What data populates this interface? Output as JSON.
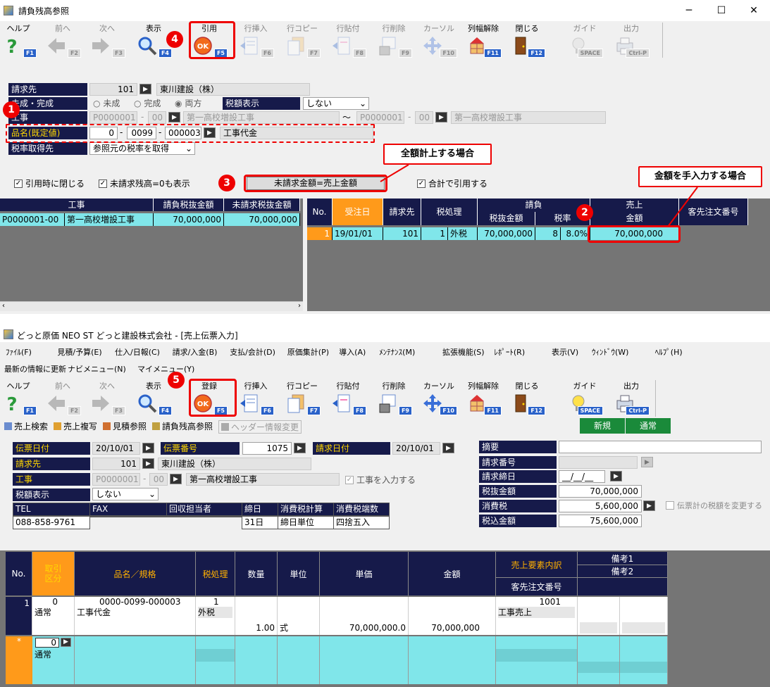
{
  "top": {
    "title": "請負残高参照",
    "toolbar": [
      {
        "label": "ヘルプ",
        "key": "F1",
        "icon": "help-icon",
        "enabled": true
      },
      {
        "label": "前へ",
        "key": "F2",
        "icon": "arrow-left-icon",
        "enabled": false
      },
      {
        "label": "次へ",
        "key": "F3",
        "icon": "arrow-right-icon",
        "enabled": false
      },
      {
        "label": "表示",
        "key": "F4",
        "icon": "magnifier-icon",
        "enabled": true
      },
      {
        "label": "引用",
        "key": "F5",
        "icon": "ok-icon",
        "enabled": true
      },
      {
        "label": "行挿入",
        "key": "F6",
        "icon": "row-insert-icon",
        "enabled": false
      },
      {
        "label": "行コピー",
        "key": "F7",
        "icon": "row-copy-icon",
        "enabled": false
      },
      {
        "label": "行貼付",
        "key": "F8",
        "icon": "row-paste-icon",
        "enabled": false
      },
      {
        "label": "行削除",
        "key": "F9",
        "icon": "row-delete-icon",
        "enabled": false
      },
      {
        "label": "カーソル",
        "key": "F10",
        "icon": "cursor-icon",
        "enabled": false
      },
      {
        "label": "列幅解除",
        "key": "F11",
        "icon": "column-width-icon",
        "enabled": true
      },
      {
        "label": "閉じる",
        "key": "F12",
        "icon": "door-icon",
        "enabled": true
      },
      {
        "label": "ガイド",
        "key": "SPACE",
        "icon": "bulb-icon",
        "enabled": false
      },
      {
        "label": "出力",
        "key": "Ctrl-P",
        "icon": "printer-icon",
        "enabled": false
      }
    ],
    "form": {
      "seikyu_label": "請求先",
      "seikyu_code": "101",
      "seikyu_name": "東川建設（株）",
      "mikan_label": "未成・完成",
      "radio1": "未成",
      "radio2": "完成",
      "radio3": "両方",
      "zei_label": "税額表示",
      "zei_value": "しない",
      "koji_label": "工事",
      "koji_from": "P0000001",
      "koji_from_sub": "00",
      "koji_from_name": "第一高校増設工事",
      "tilde": "～",
      "koji_to": "P0000001",
      "koji_to_sub": "00",
      "koji_to_name": "第一高校増設工事",
      "hinmei_label": "品名(既定値)",
      "hin1": "0",
      "hin2": "0099",
      "hin3": "000003",
      "hin_name": "工事代金",
      "zeiritsu_label": "税率取得先",
      "zeiritsu_value": "参照元の税率を取得",
      "chk1": "引用時に閉じる",
      "chk2": "未請求残高=0も表示",
      "btn_label": "未請求金額=売上金額",
      "chk3": "合計で引用する"
    },
    "left_grid": {
      "headers": [
        "工事",
        "請負税抜金額",
        "未請求税抜金額"
      ],
      "row": [
        "P0000001-00",
        "第一高校増設工事",
        "70,000,000",
        "70,000,000"
      ]
    },
    "right_grid": {
      "h_no": "No.",
      "h_date": "受注日",
      "h_seikyu": "請求先",
      "h_zei": "税処理",
      "h_ukeoi": "請負",
      "h_zeinuki": "税抜金額",
      "h_zeiritsu": "税率",
      "h_uriage": "売上",
      "h_kingaku": "金額",
      "h_kyaku": "客先注文番号",
      "row": {
        "no": "1",
        "date": "19/01/01",
        "seikyu": "101",
        "zeicode": "1",
        "zei": "外税",
        "zeinuki": "70,000,000",
        "rate_code": "8",
        "rate": "8.0%",
        "kingaku": "70,000,000",
        "kyaku": ""
      }
    },
    "callout1": "全額計上する場合",
    "callout2": "金額を手入力する場合"
  },
  "bottom": {
    "title": "どっと原価 NEO ST どっと建設株式会社 - [売上伝票入力]",
    "menu": [
      "ﾌｧｲﾙ(F)",
      "見積/予算(E)",
      "仕入/日報(C)",
      "請求/入金(B)",
      "支払/会計(D)",
      "原価集計(P)",
      "導入(A)",
      "ﾒﾝﾃﾅﾝｽ(M)",
      "拡張機能(S)",
      "ﾚﾎﾟｰﾄ(R)",
      "表示(V)",
      "ｳｨﾝﾄﾞｳ(W)",
      "ﾍﾙﾌﾟ(H)"
    ],
    "submenu": [
      "最新の情報に更新",
      "ナビメニュー(N)",
      "マイメニュー(Y)"
    ],
    "toolbar": [
      {
        "label": "ヘルプ",
        "key": "F1",
        "icon": "help-icon",
        "enabled": true
      },
      {
        "label": "前へ",
        "key": "F2",
        "icon": "arrow-left-icon",
        "enabled": false
      },
      {
        "label": "次へ",
        "key": "F3",
        "icon": "arrow-right-icon",
        "enabled": false
      },
      {
        "label": "表示",
        "key": "F4",
        "icon": "magnifier-icon",
        "enabled": true
      },
      {
        "label": "登録",
        "key": "F5",
        "icon": "ok-icon",
        "enabled": true
      },
      {
        "label": "行挿入",
        "key": "F6",
        "icon": "row-insert-icon",
        "enabled": true
      },
      {
        "label": "行コピー",
        "key": "F7",
        "icon": "row-copy-icon",
        "enabled": true
      },
      {
        "label": "行貼付",
        "key": "F8",
        "icon": "row-paste-icon",
        "enabled": true
      },
      {
        "label": "行削除",
        "key": "F9",
        "icon": "row-delete-icon",
        "enabled": true
      },
      {
        "label": "カーソル",
        "key": "F10",
        "icon": "cursor-icon",
        "enabled": true
      },
      {
        "label": "列幅解除",
        "key": "F11",
        "icon": "column-width-icon",
        "enabled": true
      },
      {
        "label": "閉じる",
        "key": "F12",
        "icon": "door-icon",
        "enabled": true
      },
      {
        "label": "ガイド",
        "key": "SPACE",
        "icon": "bulb-icon",
        "enabled": true
      },
      {
        "label": "出力",
        "key": "Ctrl-P",
        "icon": "printer-icon",
        "enabled": true
      }
    ],
    "actions": [
      "売上検索",
      "売上複写",
      "見積参照",
      "請負残高参照",
      "ヘッダー情報変更"
    ],
    "status": [
      "新規",
      "通常"
    ],
    "form": {
      "denpyo_date_label": "伝票日付",
      "denpyo_date": "20/10/01",
      "denpyo_no_label": "伝票番号",
      "denpyo_no": "1075",
      "seikyu_date_label": "請求日付",
      "seikyu_date": "20/10/01",
      "seikyu_label": "請求先",
      "seikyu_code": "101",
      "seikyu_name": "東川建設（株）",
      "koji_label": "工事",
      "koji_code": "P0000001",
      "koji_sub": "00",
      "koji_name": "第一高校増設工事",
      "koji_chk": "工事を入力する",
      "zei_label": "税額表示",
      "zei_value": "しない",
      "tel_h": "TEL",
      "fax_h": "FAX",
      "kaishu_h": "回収担当者",
      "shime_h": "締日",
      "shohi_h": "消費税計算",
      "hasu_h": "消費税端数",
      "tel": "088-858-9761",
      "fax": "",
      "kaishu": "",
      "shime": "31日",
      "shohi": "締日単位",
      "hasu": "四捨五入",
      "tekiyo_label": "摘要",
      "tekiyo": "",
      "seikyu_no_label": "請求番号",
      "seikyu_no": "",
      "seikyu_shime_label": "請求締日",
      "seikyu_shime": "__/__/__",
      "zeinuki_label": "税抜金額",
      "zeinuki": "70,000,000",
      "shohizei_label": "消費税",
      "shohizei": "5,600,000",
      "zeikomi_label": "税込金額",
      "zeikomi": "75,600,000",
      "zei_change": "伝票計の税額を変更する"
    },
    "grid": {
      "h_no": "No.",
      "h_torihiki": "取引区分",
      "h_hinmei": "品名／規格",
      "h_zei": "税処理",
      "h_suryo": "数量",
      "h_tani": "単位",
      "h_tanka": "単価",
      "h_kingaku": "金額",
      "h_uchiwake": "売上要素内訳",
      "h_kyaku": "客先注文番号",
      "h_biko1": "備考1",
      "h_biko2": "備考2",
      "row": {
        "no": "1",
        "torihiki_code": "0",
        "torihiki": "通常",
        "hin_code": "0000-0099-000003",
        "hin_name": "工事代金",
        "zei_code": "1",
        "zei": "外税",
        "suryo": "1.00",
        "tani": "式",
        "tanka": "70,000,000.0",
        "kingaku": "70,000,000",
        "uchiwake_code": "1001",
        "uchiwake": "工事売上"
      },
      "new_row": {
        "marker": "*",
        "code": "0",
        "torihiki": "通常"
      }
    }
  },
  "annotations": {
    "n1": "1",
    "n2": "2",
    "n3": "3",
    "n4": "4",
    "n5": "5"
  },
  "colors": {
    "navy": "#161a4a",
    "cyan": "#80e6ea",
    "red": "#e00000",
    "orange": "#ff9a1a",
    "green": "#1a8a3a"
  }
}
